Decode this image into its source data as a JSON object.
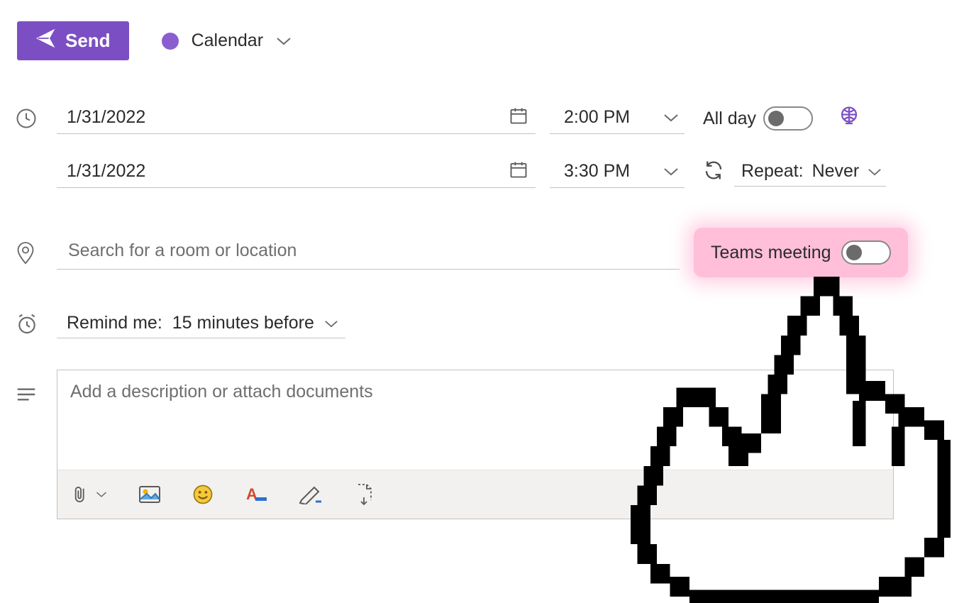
{
  "header": {
    "send_label": "Send",
    "calendar_label": "Calendar"
  },
  "datetime": {
    "start_date": "1/31/2022",
    "start_time": "2:00 PM",
    "end_date": "1/31/2022",
    "end_time": "3:30 PM",
    "allday_label": "All day",
    "allday_on": false,
    "repeat_label": "Repeat:",
    "repeat_value": "Never"
  },
  "location": {
    "placeholder": "Search for a room or location",
    "value": "",
    "teams_label": "Teams meeting",
    "teams_on": false
  },
  "remind": {
    "label": "Remind me:",
    "value": "15 minutes before"
  },
  "description": {
    "placeholder": "Add a description or attach documents"
  }
}
